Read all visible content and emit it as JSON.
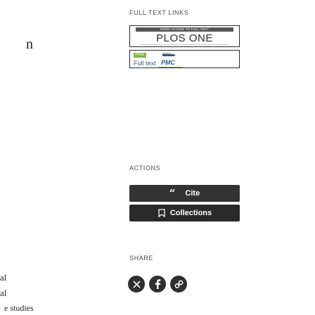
{
  "left_fragments": {
    "m": "n",
    "al_1": "al",
    "al_2": "al",
    "studies": "e studies"
  },
  "full_text_links": {
    "label": "FULL TEXT LINKS",
    "plos": {
      "banner": "OPEN ACCESS TO FULL TEXT",
      "name": "PLOS ONE"
    },
    "pmc": {
      "badge": "FREE",
      "fulltext": "Full text",
      "name": "PMC"
    }
  },
  "actions": {
    "label": "ACTIONS",
    "cite_label": "Cite",
    "collections_label": "Collections"
  },
  "share": {
    "label": "SHARE",
    "icons": [
      "twitter-icon",
      "facebook-icon",
      "link-icon"
    ]
  },
  "colors": {
    "button_bg": "#333333",
    "pmc_blue": "#2e5a88",
    "free_green": "#7cb342"
  }
}
